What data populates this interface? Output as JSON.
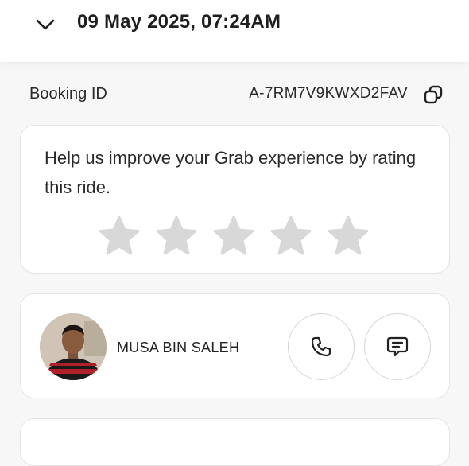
{
  "header": {
    "title": "09 May 2025, 07:24AM",
    "collapse_icon": "chevron-down-icon"
  },
  "booking": {
    "label": "Booking ID",
    "value": "A-7RM7V9KWXD2FAV",
    "copy_icon": "copy-icon"
  },
  "rating": {
    "prompt": "Help us improve your Grab experience by rating this ride.",
    "stars_total": 5,
    "stars_selected": 0,
    "star_color": "#d8d8d8"
  },
  "driver": {
    "name": "MUSA BIN SALEH",
    "call_icon": "phone-icon",
    "chat_icon": "chat-icon"
  },
  "colors": {
    "background": "#f7f7f7",
    "card": "#ffffff",
    "border": "#e4e4e4",
    "text": "#1c1c1c"
  }
}
